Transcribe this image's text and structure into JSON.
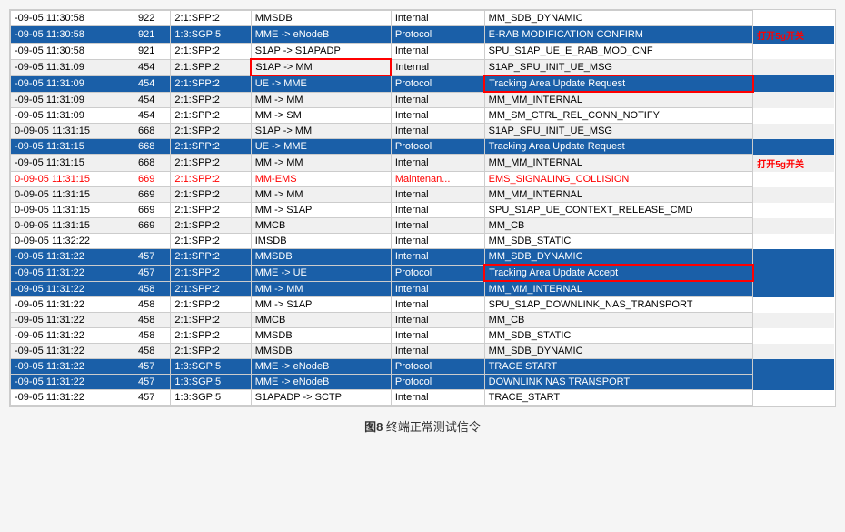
{
  "caption": {
    "number": "图8",
    "text": "终端正常测试信令"
  },
  "table": {
    "rows": [
      {
        "id": "r1",
        "style": "normal",
        "time": "-09-05 11:30:58",
        "num": "922",
        "node": "2:1:SPP:2",
        "src_dst": "MMSDB",
        "type": "Internal",
        "message": "MM_SDB_DYNAMIC",
        "highlight": false
      },
      {
        "id": "r2",
        "style": "blue",
        "time": "-09-05 11:30:58",
        "num": "921",
        "node": "1:3:SGP:5",
        "src_dst": "MME -> eNodeB",
        "type": "Protocol",
        "message": "E-RAB MODIFICATION CONFIRM",
        "annotation_right": "打开5g开关",
        "highlight": true
      },
      {
        "id": "r3",
        "style": "normal",
        "time": "-09-05 11:30:58",
        "num": "921",
        "node": "2:1:SPP:2",
        "src_dst": "S1AP -> S1APADP",
        "type": "Internal",
        "message": "SPU_S1AP_UE_E_RAB_MOD_CNF",
        "highlight": false
      },
      {
        "id": "r4",
        "style": "normal",
        "time": "-09-05 11:31:09",
        "num": "454",
        "node": "2:1:SPP:2",
        "src_dst": "S1AP -> MM",
        "type": "Internal",
        "message": "S1AP_SPU_INIT_UE_MSG",
        "red_border": true,
        "highlight": false
      },
      {
        "id": "r5",
        "style": "blue",
        "time": "-09-05 11:31:09",
        "num": "454",
        "node": "2:1:SPP:2",
        "src_dst": "UE -> MME",
        "type": "Protocol",
        "message": "Tracking Area Update Request",
        "red_border_msg": true,
        "highlight": true
      },
      {
        "id": "r6",
        "style": "normal",
        "time": "-09-05 11:31:09",
        "num": "454",
        "node": "2:1:SPP:2",
        "src_dst": "MM -> MM",
        "type": "Internal",
        "message": "MM_MM_INTERNAL",
        "highlight": false
      },
      {
        "id": "r7",
        "style": "normal",
        "time": "-09-05 11:31:09",
        "num": "454",
        "node": "2:1:SPP:2",
        "src_dst": "MM -> SM",
        "type": "Internal",
        "message": "MM_SM_CTRL_REL_CONN_NOTIFY",
        "highlight": false
      },
      {
        "id": "r8",
        "style": "normal",
        "time": "0-09-05 11:31:15",
        "num": "668",
        "node": "2:1:SPP:2",
        "src_dst": "S1AP -> MM",
        "type": "Internal",
        "message": "S1AP_SPU_INIT_UE_MSG",
        "highlight": false
      },
      {
        "id": "r9",
        "style": "blue",
        "time": "-09-05 11:31:15",
        "num": "668",
        "node": "2:1:SPP:2",
        "src_dst": "UE -> MME",
        "type": "Protocol",
        "message": "Tracking Area Update Request",
        "highlight": true
      },
      {
        "id": "r10",
        "style": "normal",
        "time": "-09-05 11:31:15",
        "num": "668",
        "node": "2:1:SPP:2",
        "src_dst": "MM -> MM",
        "type": "Internal",
        "message": "MM_MM_INTERNAL",
        "annotation_right": "打开5g开关",
        "highlight": false
      },
      {
        "id": "r11",
        "style": "red_row",
        "time": "0-09-05 11:31:15",
        "num": "669",
        "node": "2:1:SPP:2",
        "src_dst": "MM-EMS",
        "type": "Maintenan...",
        "message": "EMS_SIGNALING_COLLISION",
        "highlight": false
      },
      {
        "id": "r12",
        "style": "normal",
        "time": "0-09-05 11:31:15",
        "num": "669",
        "node": "2:1:SPP:2",
        "src_dst": "MM -> MM",
        "type": "Internal",
        "message": "MM_MM_INTERNAL",
        "highlight": false
      },
      {
        "id": "r13",
        "style": "normal",
        "time": "0-09-05 11:31:15",
        "num": "669",
        "node": "2:1:SPP:2",
        "src_dst": "MM -> S1AP",
        "type": "Internal",
        "message": "SPU_S1AP_UE_CONTEXT_RELEASE_CMD",
        "highlight": false
      },
      {
        "id": "r14",
        "style": "normal",
        "time": "0-09-05 11:31:15",
        "num": "669",
        "node": "2:1:SPP:2",
        "src_dst": "MMCB",
        "type": "Internal",
        "message": "MM_CB",
        "highlight": false
      },
      {
        "id": "r15",
        "style": "light",
        "time": "0-09-05 11:32:22",
        "num": "",
        "node": "2:1:SPP:2",
        "src_dst": "IMSDB",
        "type": "Internal",
        "message": "MM_SDB_STATIC",
        "highlight": false
      },
      {
        "id": "r16",
        "style": "blue",
        "time": "-09-05 11:31:22",
        "num": "457",
        "node": "2:1:SPP:2",
        "src_dst": "MMSDB",
        "type": "Internal",
        "message": "MM_SDB_DYNAMIC",
        "highlight": true
      },
      {
        "id": "r17",
        "style": "blue",
        "time": "-09-05 11:31:22",
        "num": "457",
        "node": "2:1:SPP:2",
        "src_dst": "MME -> UE",
        "type": "Protocol",
        "message": "Tracking Area Update Accept",
        "red_border_msg": true,
        "highlight": true
      },
      {
        "id": "r18",
        "style": "blue",
        "time": "-09-05 11:31:22",
        "num": "458",
        "node": "2:1:SPP:2",
        "src_dst": "MM -> MM",
        "type": "Internal",
        "message": "MM_MM_INTERNAL",
        "highlight": true
      },
      {
        "id": "r19",
        "style": "normal",
        "time": "-09-05 11:31:22",
        "num": "458",
        "node": "2:1:SPP:2",
        "src_dst": "MM -> S1AP",
        "type": "Internal",
        "message": "SPU_S1AP_DOWNLINK_NAS_TRANSPORT",
        "highlight": false
      },
      {
        "id": "r20",
        "style": "normal",
        "time": "-09-05 11:31:22",
        "num": "458",
        "node": "2:1:SPP:2",
        "src_dst": "MMCB",
        "type": "Internal",
        "message": "MM_CB",
        "highlight": false
      },
      {
        "id": "r21",
        "style": "normal",
        "time": "-09-05 11:31:22",
        "num": "458",
        "node": "2:1:SPP:2",
        "src_dst": "MMSDB",
        "type": "Internal",
        "message": "MM_SDB_STATIC",
        "highlight": false
      },
      {
        "id": "r22",
        "style": "normal",
        "time": "-09-05 11:31:22",
        "num": "458",
        "node": "2:1:SPP:2",
        "src_dst": "MMSDB",
        "type": "Internal",
        "message": "MM_SDB_DYNAMIC",
        "highlight": false
      },
      {
        "id": "r23",
        "style": "blue",
        "time": "-09-05 11:31:22",
        "num": "457",
        "node": "1:3:SGP:5",
        "src_dst": "MME -> eNodeB",
        "type": "Protocol",
        "message": "TRACE START",
        "highlight": true
      },
      {
        "id": "r24",
        "style": "blue",
        "time": "-09-05 11:31:22",
        "num": "457",
        "node": "1:3:SGP:5",
        "src_dst": "MME -> eNodeB",
        "type": "Protocol",
        "message": "DOWNLINK NAS TRANSPORT",
        "highlight": true
      },
      {
        "id": "r25",
        "style": "normal",
        "time": "-09-05 11:31:22",
        "num": "457",
        "node": "1:3:SGP:5",
        "src_dst": "S1APADP -> SCTP",
        "type": "Internal",
        "message": "TRACE_START",
        "highlight": false
      }
    ]
  }
}
